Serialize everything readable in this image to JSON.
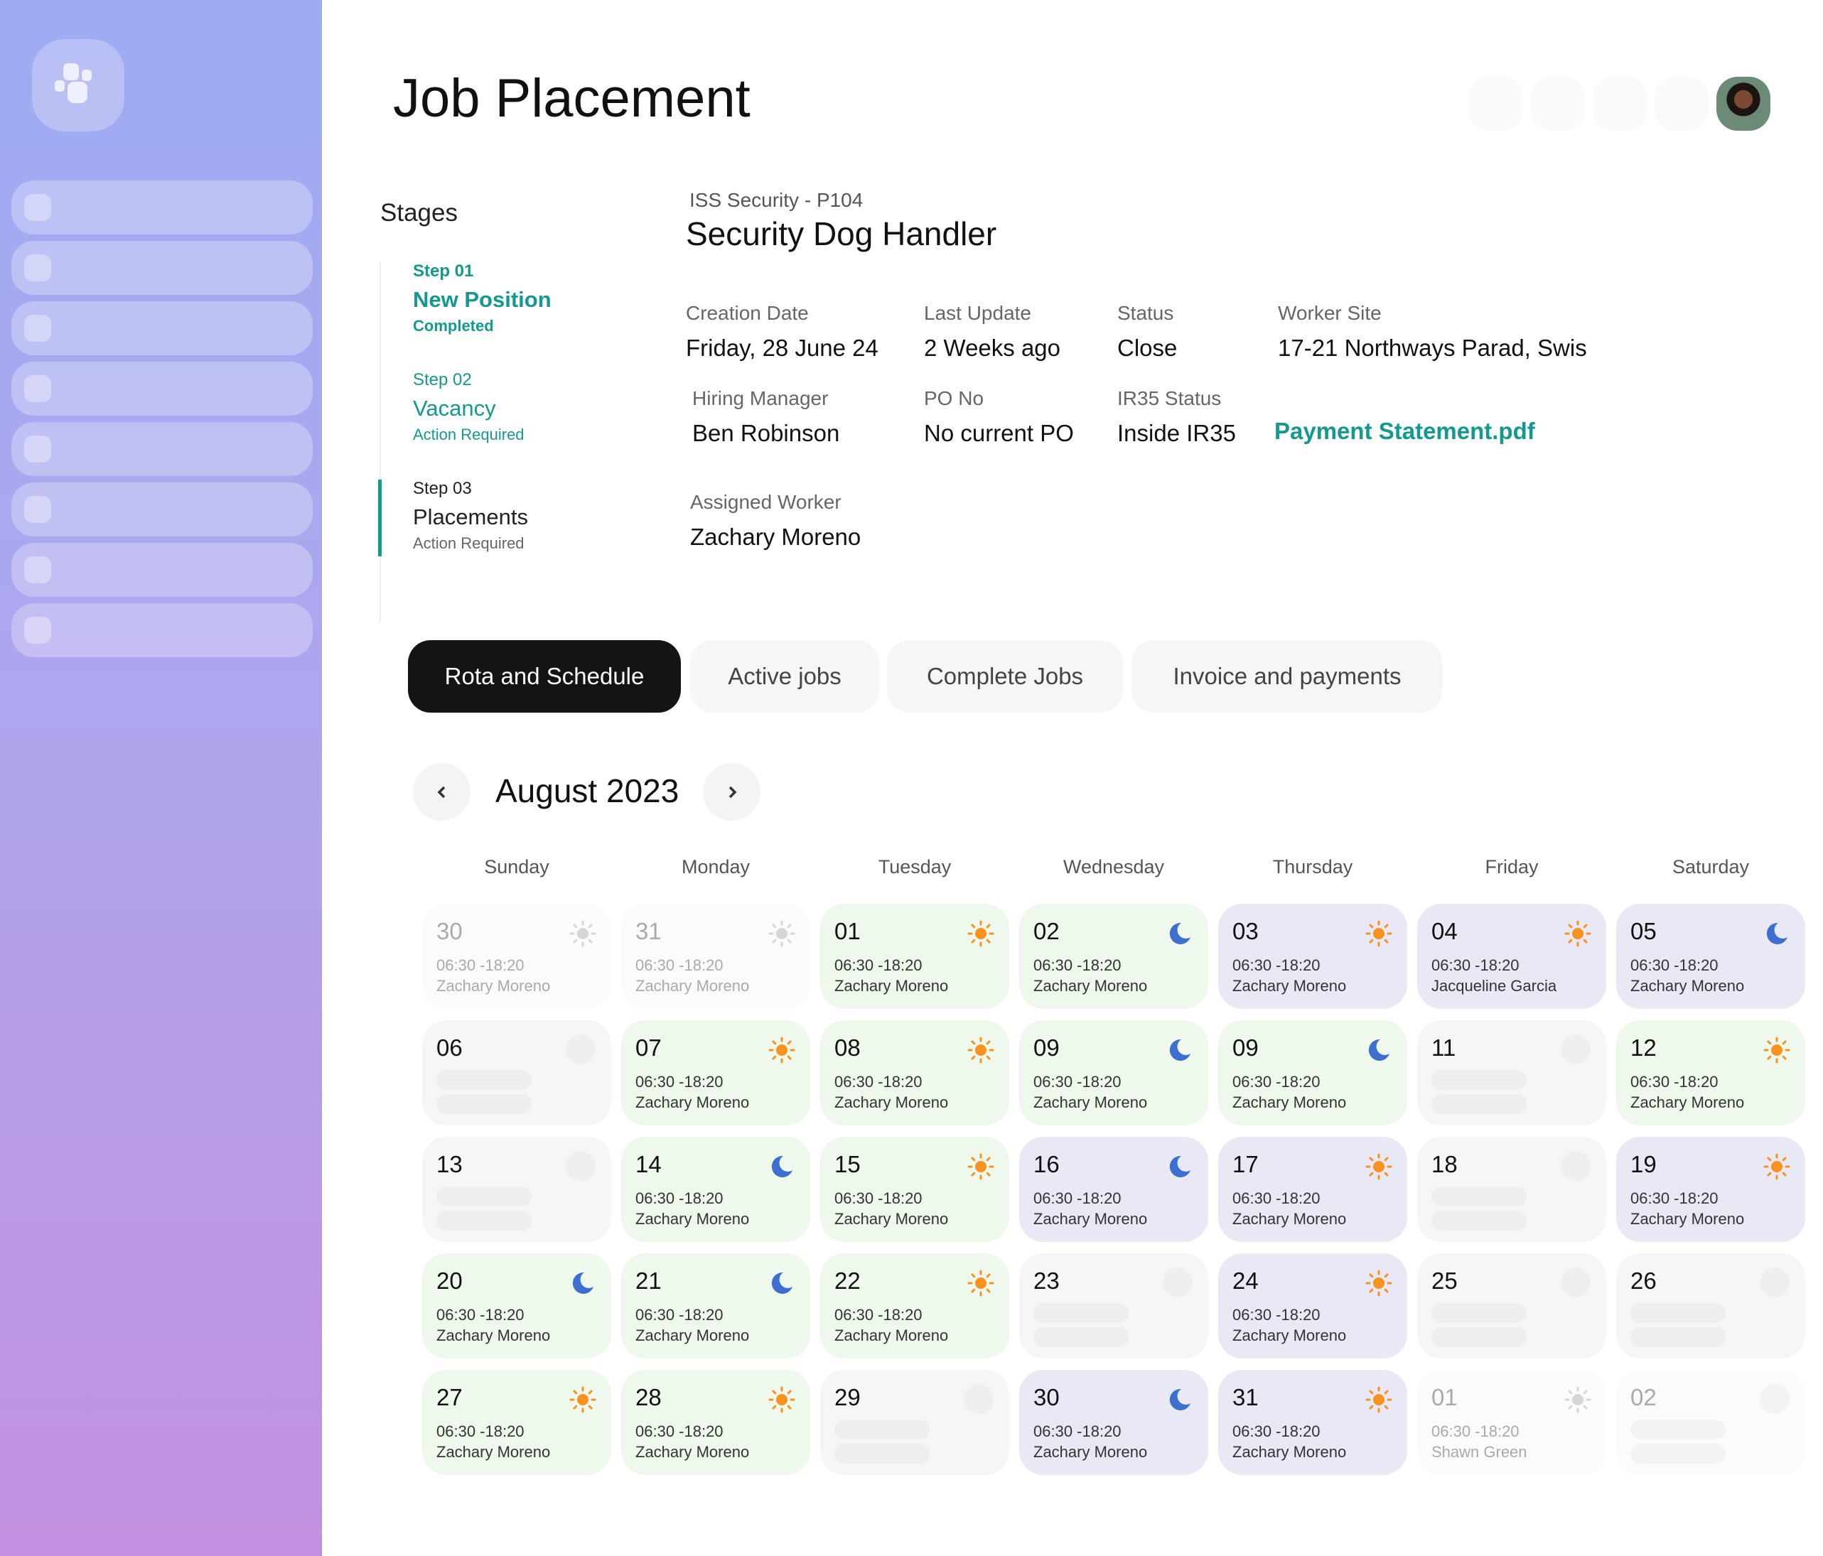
{
  "header": {
    "title": "Job Placement"
  },
  "stages": {
    "heading": "Stages",
    "items": [
      {
        "step": "Step 01",
        "title": "New Position",
        "status": "Completed",
        "state": "completed"
      },
      {
        "step": "Step 02",
        "title": "Vacancy",
        "status": "Action Required",
        "state": "pending"
      },
      {
        "step": "Step 03",
        "title": "Placements",
        "status": "Action Required",
        "state": "active"
      }
    ]
  },
  "job": {
    "client": "ISS Security - P104",
    "title": "Security Dog Handler",
    "fields": [
      {
        "label": "Creation Date",
        "value": "Friday, 28 June 24"
      },
      {
        "label": "Last Update",
        "value": "2 Weeks ago"
      },
      {
        "label": "Status",
        "value": "Close"
      },
      {
        "label": "Worker Site",
        "value": "17-21 Northways Parad, Swis"
      },
      {
        "label": "Hiring Manager",
        "value": "Ben Robinson"
      },
      {
        "label": "PO No",
        "value": "No current PO"
      },
      {
        "label": "IR35 Status",
        "value": "Inside IR35"
      },
      {
        "label": "Assigned Worker",
        "value": "Zachary Moreno"
      }
    ],
    "attachment": "Payment Statement.pdf"
  },
  "tabs": [
    {
      "label": "Rota and Schedule",
      "active": true
    },
    {
      "label": "Active jobs"
    },
    {
      "label": "Complete Jobs"
    },
    {
      "label": "Invoice and payments"
    }
  ],
  "calendar": {
    "month": "August 2023",
    "weekdays": [
      "Sunday",
      "Monday",
      "Tuesday",
      "Wednesday",
      "Thursday",
      "Friday",
      "Saturday"
    ],
    "colors": {
      "day_shift": "#f7931e",
      "night_shift": "#3d6fd1",
      "green": "#eff8ec",
      "purple": "#e9e9f5",
      "accent": "#139a90"
    },
    "weeks": [
      [
        {
          "d": "30",
          "t": "06:30 -18:20",
          "w": "Zachary Moreno",
          "i": "sun",
          "s": "faded"
        },
        {
          "d": "31",
          "t": "06:30 -18:20",
          "w": "Zachary Moreno",
          "i": "sun",
          "s": "faded"
        },
        {
          "d": "01",
          "t": "06:30 -18:20",
          "w": "Zachary Moreno",
          "i": "sun",
          "s": "green"
        },
        {
          "d": "02",
          "t": "06:30 -18:20",
          "w": "Zachary Moreno",
          "i": "moon",
          "s": "green"
        },
        {
          "d": "03",
          "t": "06:30 -18:20",
          "w": "Zachary Moreno",
          "i": "sun",
          "s": "purple"
        },
        {
          "d": "04",
          "t": "06:30 -18:20",
          "w": "Jacqueline Garcia",
          "i": "sun",
          "s": "purple"
        },
        {
          "d": "05",
          "t": "06:30 -18:20",
          "w": "Zachary Moreno",
          "i": "moon",
          "s": "purple"
        }
      ],
      [
        {
          "d": "06",
          "s": "empty"
        },
        {
          "d": "07",
          "t": "06:30 -18:20",
          "w": "Zachary Moreno",
          "i": "sun",
          "s": "green"
        },
        {
          "d": "08",
          "t": "06:30 -18:20",
          "w": "Zachary Moreno",
          "i": "sun",
          "s": "green"
        },
        {
          "d": "09",
          "t": "06:30 -18:20",
          "w": "Zachary Moreno",
          "i": "moon",
          "s": "green"
        },
        {
          "d": "09",
          "t": "06:30 -18:20",
          "w": "Zachary Moreno",
          "i": "moon",
          "s": "green"
        },
        {
          "d": "11",
          "s": "empty"
        },
        {
          "d": "12",
          "t": "06:30 -18:20",
          "w": "Zachary Moreno",
          "i": "sun",
          "s": "green"
        }
      ],
      [
        {
          "d": "13",
          "s": "empty"
        },
        {
          "d": "14",
          "t": "06:30 -18:20",
          "w": "Zachary Moreno",
          "i": "moon",
          "s": "green"
        },
        {
          "d": "15",
          "t": "06:30 -18:20",
          "w": "Zachary Moreno",
          "i": "sun",
          "s": "green"
        },
        {
          "d": "16",
          "t": "06:30 -18:20",
          "w": "Zachary Moreno",
          "i": "moon",
          "s": "purple"
        },
        {
          "d": "17",
          "t": "06:30 -18:20",
          "w": "Zachary Moreno",
          "i": "sun",
          "s": "purple"
        },
        {
          "d": "18",
          "s": "empty"
        },
        {
          "d": "19",
          "t": "06:30 -18:20",
          "w": "Zachary Moreno",
          "i": "sun",
          "s": "purple"
        }
      ],
      [
        {
          "d": "20",
          "t": "06:30 -18:20",
          "w": "Zachary Moreno",
          "i": "moon",
          "s": "green"
        },
        {
          "d": "21",
          "t": "06:30 -18:20",
          "w": "Zachary Moreno",
          "i": "moon",
          "s": "green"
        },
        {
          "d": "22",
          "t": "06:30 -18:20",
          "w": "Zachary Moreno",
          "i": "sun",
          "s": "green"
        },
        {
          "d": "23",
          "s": "empty"
        },
        {
          "d": "24",
          "t": "06:30 -18:20",
          "w": "Zachary Moreno",
          "i": "sun",
          "s": "purple"
        },
        {
          "d": "25",
          "s": "empty"
        },
        {
          "d": "26",
          "s": "empty"
        }
      ],
      [
        {
          "d": "27",
          "t": "06:30 -18:20",
          "w": "Zachary Moreno",
          "i": "sun",
          "s": "green"
        },
        {
          "d": "28",
          "t": "06:30 -18:20",
          "w": "Zachary Moreno",
          "i": "sun",
          "s": "green"
        },
        {
          "d": "29",
          "s": "empty"
        },
        {
          "d": "30",
          "t": "06:30 -18:20",
          "w": "Zachary Moreno",
          "i": "moon",
          "s": "purple"
        },
        {
          "d": "31",
          "t": "06:30 -18:20",
          "w": "Zachary Moreno",
          "i": "sun",
          "s": "purple"
        },
        {
          "d": "01",
          "t": "06:30 -18:20",
          "w": "Shawn Green",
          "i": "sun",
          "s": "faded"
        },
        {
          "d": "02",
          "s": "faded-empty"
        }
      ]
    ]
  }
}
